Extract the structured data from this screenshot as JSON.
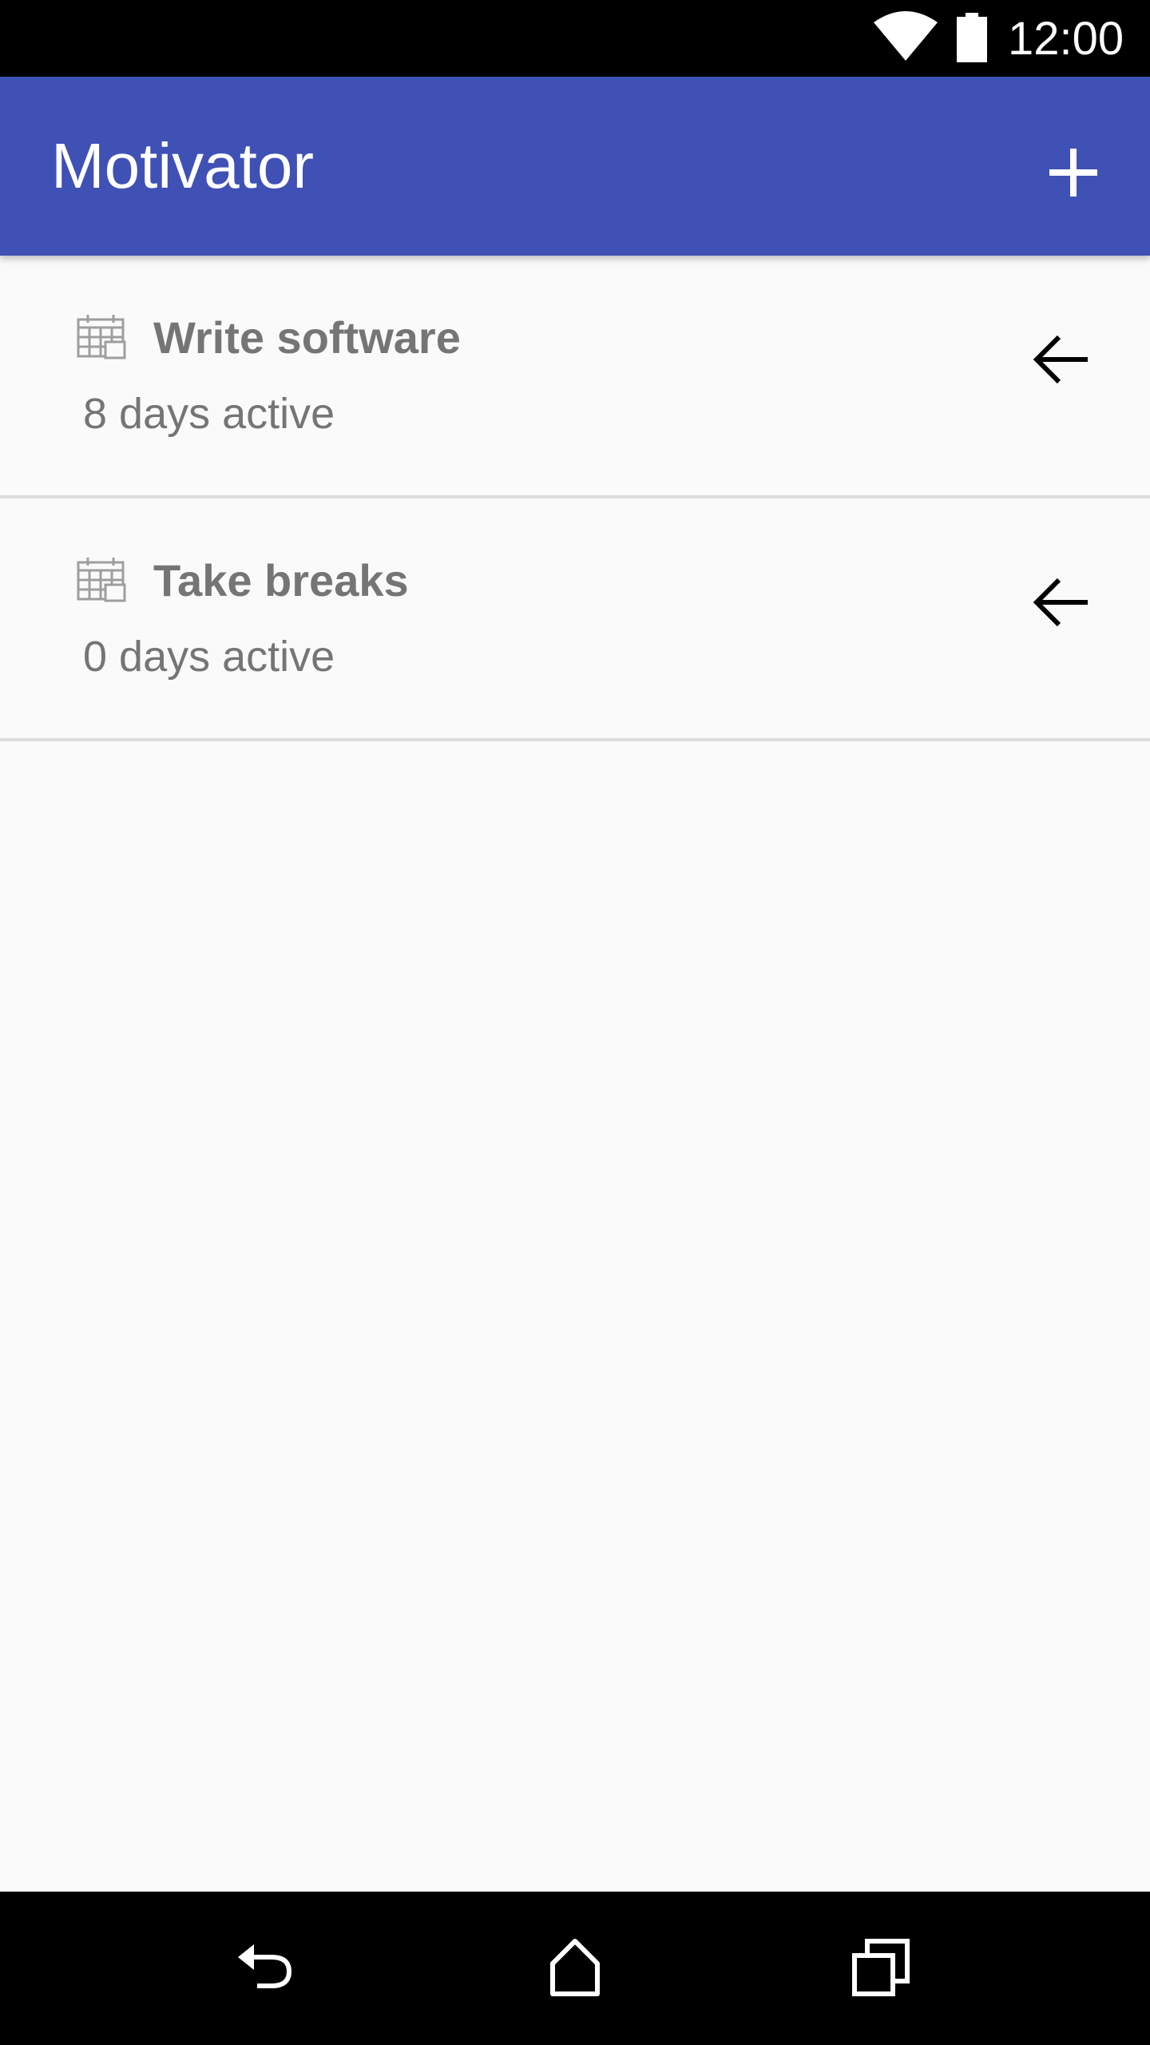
{
  "status_bar": {
    "time": "12:00",
    "icons": [
      "wifi-icon",
      "battery-icon"
    ]
  },
  "app_bar": {
    "title": "Motivator",
    "add_icon": "plus-icon",
    "color": "#3f51b5"
  },
  "list": {
    "items": [
      {
        "title": "Write software",
        "subtitle": "8 days active",
        "icon": "calendar-icon",
        "action_icon": "arrow-left-icon"
      },
      {
        "title": "Take breaks",
        "subtitle": "0 days active",
        "icon": "calendar-icon",
        "action_icon": "arrow-left-icon"
      }
    ]
  },
  "nav_bar": {
    "icons": [
      "back-icon",
      "home-icon",
      "recents-icon"
    ]
  }
}
